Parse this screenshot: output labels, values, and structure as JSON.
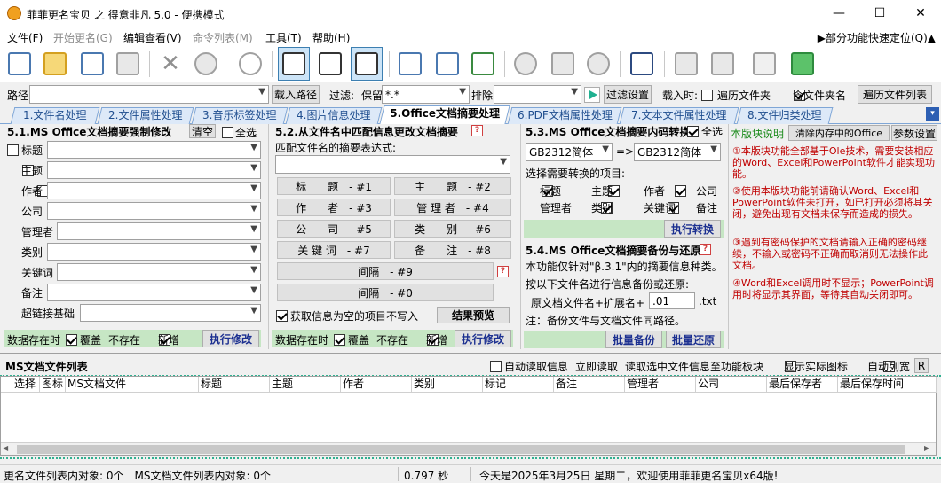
{
  "window": {
    "title": "菲菲更名宝贝 之 得意非凡 5.0 - 便携模式",
    "minimize": "—",
    "maximize": "☐",
    "close": "✕"
  },
  "menu": {
    "items": [
      "文件(F)",
      "开始更名(G)",
      "编辑查看(V)",
      "命令列表(M)",
      "工具(T)",
      "帮助(H)"
    ],
    "quick": "▶部分功能快速定位(Q)▲"
  },
  "toolbar": {
    "icons": [
      "new-file-icon",
      "open-folder-icon",
      "import-icon",
      "copy-icon",
      "delete-icon",
      "cancel-icon",
      "refresh-icon",
      "move-right-icon",
      "move-up-icon",
      "move-down-icon",
      "column-left-icon",
      "column-grid-icon",
      "checklist-icon",
      "search-icon",
      "trash-icon",
      "check-icon",
      "sliders-icon",
      "flag-icon",
      "bookmark-icon",
      "pin-icon"
    ]
  },
  "pathbar": {
    "path_label": "路径",
    "path_value": "",
    "load_path": "载入路径",
    "filter_label": "过滤:",
    "keep_label": "保留",
    "keep_value": "*.*",
    "exclude_label": "排除",
    "exclude_value": "",
    "filter_settings": "过滤设置",
    "load_when": "载入时:",
    "traverse_dir": "遍历文件夹",
    "include_dir": "含文件夹名",
    "traverse_list": "遍历文件列表"
  },
  "tabs": [
    "1.文件名处理",
    "2.文件属性处理",
    "3.音乐标签处理",
    "4.图片信息处理",
    "5.Office文档摘要处理",
    "6.PDF文档属性处理",
    "7.文本文件属性处理",
    "8.文件归类处理"
  ],
  "tab_more": "▾",
  "panel1": {
    "title": "5.1.MS Office文档摘要强制修改",
    "clear": "清空",
    "select_all": "全选",
    "fields": [
      "标题",
      "主题",
      "作者",
      "公司",
      "管理者",
      "类别",
      "关键词",
      "备注",
      "超链接基础"
    ],
    "exists_label": "数据存在时",
    "overwrite": "覆盖",
    "not_exist": "不存在",
    "add_new": "新增",
    "execute": "执行修改"
  },
  "panel2": {
    "title": "5.2.从文件名中匹配信息更改文档摘要",
    "help": "?",
    "regex_label": "匹配文件名的摘要表达式:",
    "regex_value": "",
    "tokens": [
      "标　　题　- #1",
      "主　　题　- #2",
      "作　　者　- #3",
      "管 理 者　- #4",
      "公　　司　- #5",
      "类　　别　- #6",
      "关 键 词　- #7",
      "备　　注　- #8"
    ],
    "sep9": "间隔　- #9",
    "sep0": "间隔　- #0",
    "skip_empty": "获取信息为空的项目不写入",
    "preview": "结果预览",
    "exists_label": "数据存在时",
    "overwrite": "覆盖",
    "not_exist": "不存在",
    "add_new": "新增",
    "execute": "执行修改"
  },
  "panel3": {
    "title": "5.3.MS Office文档摘要内码转换",
    "select_all": "全选",
    "from": "GB2312简体",
    "arrow": "=>",
    "to": "GB2312简体",
    "choose_label": "选择需要转换的项目:",
    "items": [
      "标题",
      "主题",
      "作者",
      "公司",
      "管理者",
      "类别",
      "关键词",
      "备注"
    ],
    "execute": "执行转换"
  },
  "panel4": {
    "title": "5.4.MS Office文档摘要备份与还原",
    "help": "?",
    "line1": "本功能仅针对\"β.3.1\"内的摘要信息种类。",
    "line2": "按以下文件名进行信息备份或还原:",
    "orig_name": "原文档文件名+扩展名+",
    "ext_value": ".01",
    "ext_suffix": ".txt",
    "note": "注：备份文件与文档文件同路径。",
    "backup": "批量备份",
    "restore": "批量还原"
  },
  "panel5": {
    "desc_label": "本版块说明",
    "clear_office": "清除内存中的Office",
    "params": "参数设置",
    "notes": [
      "①本版块功能全部基于Ole技术，需要安装相应的Word、Excel和PowerPoint软件才能实现功能。",
      "②使用本版块功能前请确认Word、Excel和PowerPoint软件未打开，如已打开必须将其关闭，避免出现有文档未保存而造成的损失。",
      "③遇到有密码保护的文档请输入正确的密码继续，不输入或密码不正确而取消则无法操作此文档。",
      "④Word和Excel调用时不显示；PowerPoint调用时将显示其界面，等待其自动关闭即可。"
    ]
  },
  "list": {
    "title": "MS文档文件列表",
    "auto_read": "自动读取信息",
    "read_now": "立即读取",
    "read_selected": "读取选中文件信息至功能板块",
    "show_icon": "显示实际图标",
    "auto_width": "自动列宽",
    "r": "R",
    "columns": [
      "选择",
      "图标",
      "MS文档文件",
      "标题",
      "主题",
      "作者",
      "类别",
      "标记",
      "备注",
      "管理者",
      "公司",
      "最后保存者",
      "最后保存时间"
    ]
  },
  "status": {
    "left": "更名文件列表内对象: 0个　MS文档文件列表内对象: 0个",
    "time": "0.797 秒",
    "right": "今天是2025年3月25日 星期二，欢迎使用菲菲更名宝贝x64版!"
  },
  "colors": {
    "accent": "#3c7fb1",
    "tab_text": "#1f4e8f",
    "note_red": "#c00000",
    "green_bar": "#c6e6c4"
  }
}
